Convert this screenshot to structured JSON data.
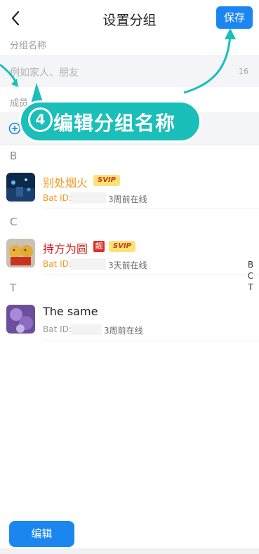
{
  "header": {
    "title": "设置分组",
    "save_label": "保存"
  },
  "group_name": {
    "section_label": "分组名称",
    "placeholder": "例如家人、朋友",
    "max_count": "16"
  },
  "members": {
    "section_label": "成员"
  },
  "contacts": [
    {
      "letter": "B",
      "name": "别处烟火",
      "badges": [
        "SVIP"
      ],
      "bat_id_label": "Bat ID:",
      "status": "3周前在线",
      "name_color": "#f59a23"
    },
    {
      "letter": "C",
      "name": "持方为圆",
      "badges": [
        "靓",
        "SVIP"
      ],
      "bat_id_label": "Bat ID:",
      "status": "3天前在线",
      "name_color": "#d81e1e"
    },
    {
      "letter": "T",
      "name": "The same",
      "badges": [],
      "bat_id_label": "Bat ID:",
      "status": "3周前在线",
      "name_color": "#222222"
    }
  ],
  "index_bar": [
    "B",
    "C",
    "T"
  ],
  "footer": {
    "edit_label": "编辑"
  },
  "tutorial": {
    "step_number": "4",
    "text": "编辑分组名称"
  },
  "colors": {
    "accent": "#1b86ef",
    "tutorial": "#19bfb8",
    "svip_bg": "#fde27a"
  }
}
